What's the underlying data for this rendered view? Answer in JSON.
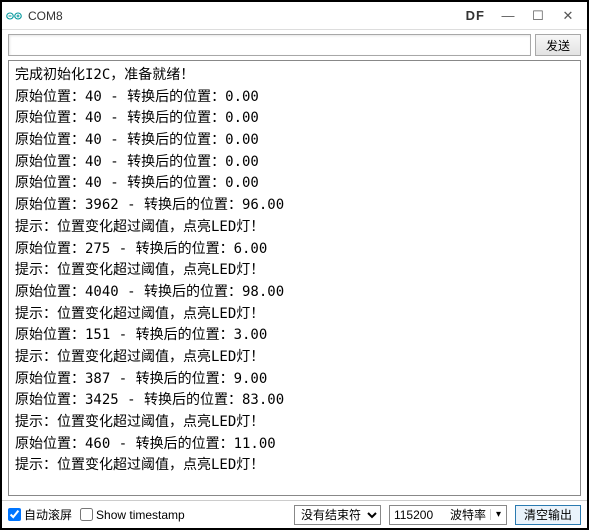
{
  "window": {
    "title": "COM8",
    "logo": "DF",
    "min_glyph": "—",
    "max_glyph": "☐",
    "close_glyph": "✕"
  },
  "input": {
    "value": "",
    "placeholder": "",
    "send_label": "发送"
  },
  "output_lines": [
    "完成初始化I2C，准备就绪！",
    "原始位置：40 - 转换后的位置：0.00",
    "原始位置：40 - 转换后的位置：0.00",
    "原始位置：40 - 转换后的位置：0.00",
    "原始位置：40 - 转换后的位置：0.00",
    "原始位置：40 - 转换后的位置：0.00",
    "原始位置：3962 - 转换后的位置：96.00",
    "提示：位置变化超过阈值，点亮LED灯！",
    "原始位置：275 - 转换后的位置：6.00",
    "提示：位置变化超过阈值，点亮LED灯！",
    "原始位置：4040 - 转换后的位置：98.00",
    "提示：位置变化超过阈值，点亮LED灯！",
    "原始位置：151 - 转换后的位置：3.00",
    "提示：位置变化超过阈值，点亮LED灯！",
    "原始位置：387 - 转换后的位置：9.00",
    "原始位置：3425 - 转换后的位置：83.00",
    "提示：位置变化超过阈值，点亮LED灯！",
    "原始位置：460 - 转换后的位置：11.00",
    "提示：位置变化超过阈值，点亮LED灯！"
  ],
  "bottom": {
    "autoscroll_label": "自动滚屏",
    "autoscroll_checked": true,
    "timestamp_label": "Show timestamp",
    "timestamp_checked": false,
    "line_ending_selected": "没有结束符",
    "baud_value": "115200",
    "baud_label": "波特率",
    "baud_arrow": "▾",
    "clear_label": "清空输出"
  }
}
